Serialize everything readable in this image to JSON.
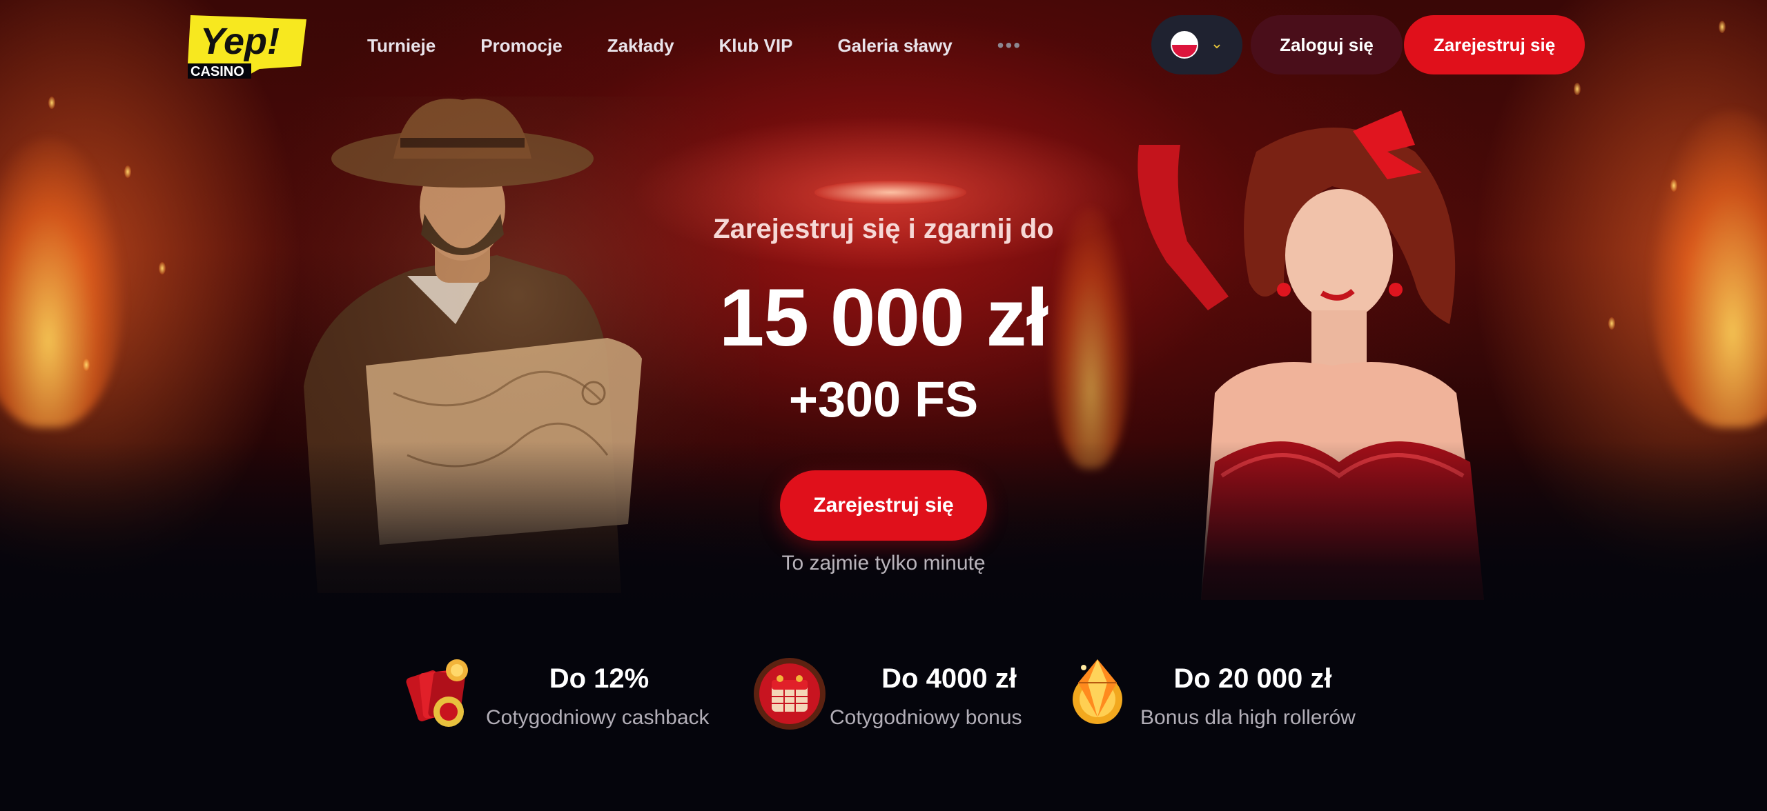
{
  "brand": {
    "logo_text": "Yep!",
    "logo_subtext": "CASINO",
    "accent_yellow": "#f7e81f",
    "accent_red": "#e0101b"
  },
  "nav": {
    "items": [
      {
        "label": "Turnieje"
      },
      {
        "label": "Promocje"
      },
      {
        "label": "Zakłady"
      },
      {
        "label": "Klub VIP"
      },
      {
        "label": "Galeria sławy"
      }
    ],
    "more_label": "•••"
  },
  "header": {
    "language_icon": "poland-flag-icon",
    "login_label": "Zaloguj się",
    "register_label": "Zarejestruj się"
  },
  "hero": {
    "subtitle": "Zarejestruj się i zgarnij do",
    "amount": "15 000 zł",
    "free_spins": "+300 FS",
    "cta_label": "Zarejestruj się",
    "cta_note": "To zajmie tylko minutę"
  },
  "features": [
    {
      "title": "Do 12%",
      "description": "Cotygodniowy cashback",
      "icon": "cards-cashback-icon"
    },
    {
      "title": "Do 4000 zł",
      "description": "Cotygodniowy bonus",
      "icon": "calendar-bonus-icon"
    },
    {
      "title": "Do 20 000 zł",
      "description": "Bonus dla high rollerów",
      "icon": "diamond-coin-icon"
    }
  ]
}
